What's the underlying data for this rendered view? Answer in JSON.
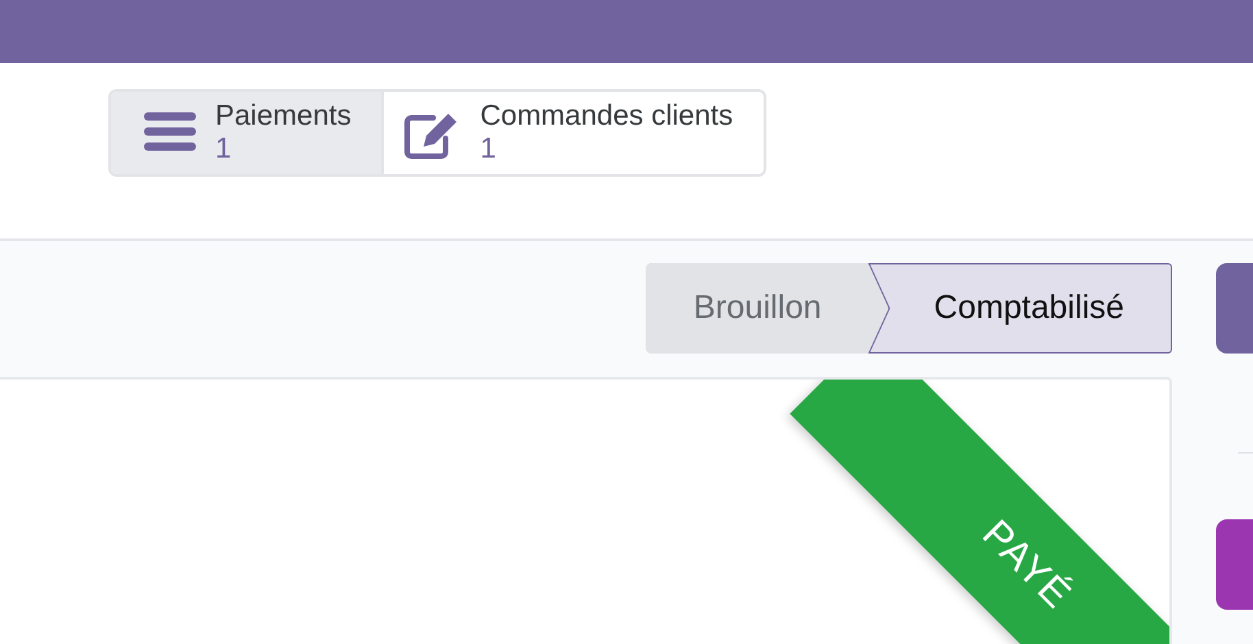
{
  "smart_buttons": [
    {
      "label": "Paiements",
      "count": "1",
      "kind": "list",
      "hovered": true
    },
    {
      "label": "Commandes clients",
      "count": "1",
      "kind": "edit",
      "hovered": false
    }
  ],
  "statusbar": [
    {
      "label": "Brouillon",
      "selected": false
    },
    {
      "label": "Comptabilisé",
      "selected": true
    }
  ],
  "ribbon": {
    "label": "PAYÉ"
  },
  "side_buttons": [
    {
      "kind": "primary"
    },
    {
      "kind": "accent"
    }
  ]
}
